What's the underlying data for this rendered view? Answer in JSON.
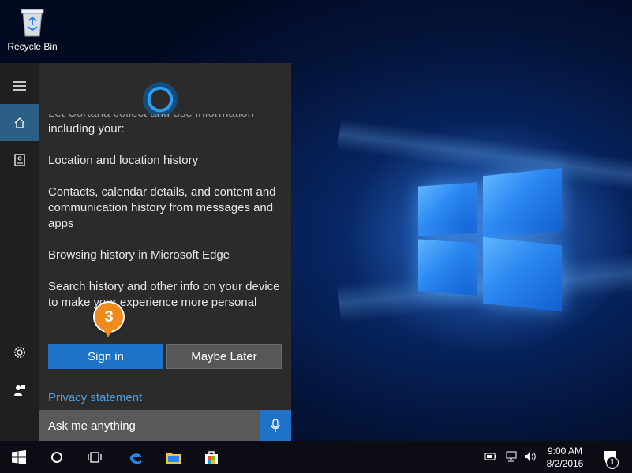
{
  "desktop": {
    "recycle_bin_label": "Recycle Bin"
  },
  "cortana": {
    "clipped_text": "Let Cortana collect and use information",
    "intro": "including your:",
    "items": [
      "Location and location history",
      "Contacts, calendar details, and content and communication history from messages and apps",
      "Browsing history in Microsoft Edge",
      "Search history and other info on your device to make your experience more personal"
    ],
    "sign_in_label": "Sign in",
    "maybe_later_label": "Maybe Later",
    "privacy_label": "Privacy statement",
    "search_placeholder": "Ask me anything",
    "rail_icons": [
      "hamburger-icon",
      "home-icon",
      "notebook-icon",
      "settings-icon",
      "feedback-icon"
    ]
  },
  "callout": {
    "step": "3",
    "color": "#f08a1a"
  },
  "taskbar": {
    "time": "9:00 AM",
    "date": "8/2/2016",
    "notification_count": "1",
    "icons": [
      "start-icon",
      "cortana-icon",
      "task-view-icon",
      "edge-icon",
      "file-explorer-icon",
      "store-icon"
    ]
  },
  "colors": {
    "accent": "#1e73c9",
    "rail_active": "#2b5f86",
    "panel_bg": "#2b2b2b",
    "link": "#4f9fe0"
  }
}
